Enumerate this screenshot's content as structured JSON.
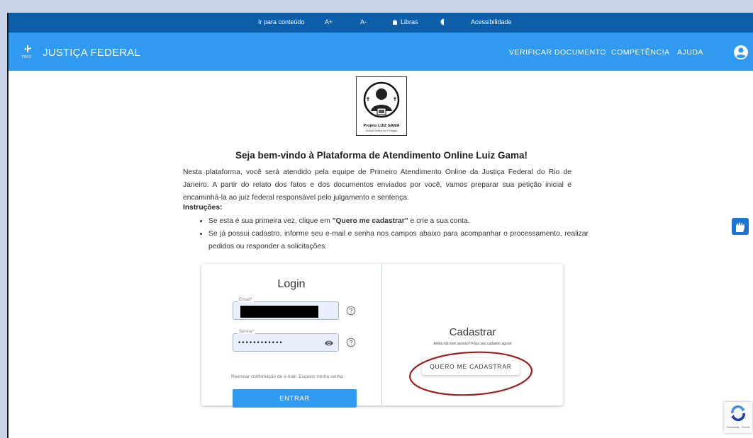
{
  "topbar": {
    "skip_link": "Ir para conteúdo",
    "font_increase": "A+",
    "font_decrease": "A-",
    "libras": "Libras",
    "accessibility": "Acessibilidade"
  },
  "navbar": {
    "brand_mark": "TRF2",
    "brand_name": "JUSTIÇA FEDERAL",
    "links": [
      "VERIFICAR DOCUMENTO",
      "COMPETÊNCIA",
      "AJUDA"
    ],
    "user_icon": "account-circle-icon"
  },
  "hero": {
    "logo_caption": "Projeto LUIZ GAMA",
    "logo_subcaption": "Justiça Federal da 2ª Região"
  },
  "welcome": {
    "title": "Seja bem-vindo à Plataforma de Atendimento Online Luiz Gama!",
    "intro": "Nesta plataforma, você será atendido pela equipe de Primeiro Atendimento Online da Justiça Federal do Rio de Janeiro. A partir do relato dos fatos e dos documentos enviados por você, vamos preparar sua petição inicial e encaminhá-la ao juiz federal responsável pelo julgamento e sentença.",
    "instructions_title": "Instruções:",
    "instruction1_pre": "Se esta é sua primeira vez, clique em ",
    "instruction1_bold": "\"Quero me cadastrar\"",
    "instruction1_post": " e crie a sua conta.",
    "instruction2": "Se já possui cadastro, informe seu e-mail e senha nos campos abaixo para acompanhar o processamento, realizar pedidos ou responder a solicitações."
  },
  "login": {
    "title": "Login",
    "email_label": "Email*",
    "email_value": "",
    "password_label": "Senha*",
    "password_value": "••••••••••••",
    "resend_link": "Reenviar confirmação de e-mail",
    "forgot_link": "Esqueci minha senha",
    "submit": "ENTRAR"
  },
  "register": {
    "title": "Cadastrar",
    "subtitle": "Ainda não tem acesso? Faça seu cadastro agora!",
    "button": "QUERO ME CADASTRAR"
  },
  "recaptcha": {
    "text": "Privacidade - Termos"
  },
  "colors": {
    "topbar": "#0c5ea8",
    "navbar": "#2f9af0",
    "primary_button": "#2f9af0",
    "annotation": "#a31b1b",
    "input_bg": "#e8eefc"
  }
}
